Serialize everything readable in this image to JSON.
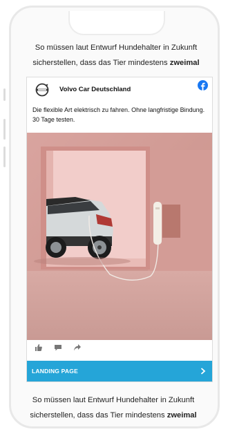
{
  "article": {
    "top_line1": "So müssen laut Entwurf Hundehalter in Zukunft",
    "top_line2_plain": "sicherstellen, dass das Tier mindestens ",
    "top_line2_bold": "zweimal",
    "bottom_line1": "So müssen laut Entwurf Hundehalter in Zukunft",
    "bottom_line2_plain": "sicherstellen, dass das Tier mindestens ",
    "bottom_line2_bold": "zweimal"
  },
  "ad": {
    "brand_name": "Volvo Car Deutschland",
    "brand_logo_icon": "volvo-logo-icon",
    "platform_icon": "facebook-icon",
    "text": "Die flexible Art elektrisch zu fahren. Ohne langfristige Bindung. 30 Tage testen.",
    "image": "electric-car-charging-pink-room",
    "reactions": [
      "like-icon",
      "comment-icon",
      "share-icon"
    ],
    "cta_label": "LANDING PAGE",
    "cta_icon": "chevron-right-icon"
  },
  "colors": {
    "cta_background": "#25a5d8",
    "facebook_blue": "#1877f2",
    "image_pink": "#e8bfbb"
  }
}
